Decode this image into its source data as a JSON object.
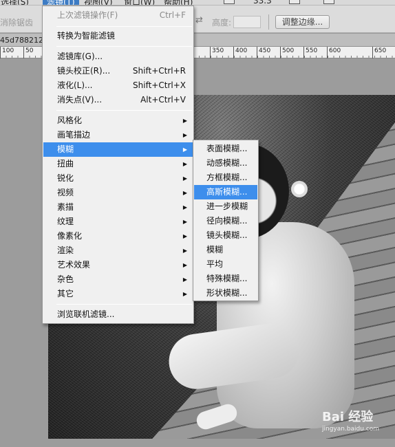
{
  "menubar": {
    "items": [
      "选择(S)",
      "滤镜(T)",
      "视图(V)",
      "窗口(W)",
      "帮助(H)"
    ],
    "zoom": "33.3"
  },
  "options": {
    "antialias_label": "消除锯齿",
    "height_label": "高度:",
    "refine_edge_button": "调整边缘..."
  },
  "document": {
    "tab_name": "45d788212"
  },
  "ruler": {
    "labels": [
      "100",
      "50",
      "350",
      "400",
      "450",
      "500",
      "550",
      "600",
      "650"
    ]
  },
  "filter_menu": {
    "last_filter": {
      "label": "上次滤镜操作(F)",
      "shortcut": "Ctrl+F"
    },
    "smart_filter": "转换为智能滤镜",
    "filter_gallery": "滤镜库(G)...",
    "lens_correction": {
      "label": "镜头校正(R)...",
      "shortcut": "Shift+Ctrl+R"
    },
    "liquify": {
      "label": "液化(L)...",
      "shortcut": "Shift+Ctrl+X"
    },
    "vanishing_point": {
      "label": "消失点(V)...",
      "shortcut": "Alt+Ctrl+V"
    },
    "categories": [
      "风格化",
      "画笔描边",
      "模糊",
      "扭曲",
      "锐化",
      "视频",
      "素描",
      "纹理",
      "像素化",
      "渲染",
      "艺术效果",
      "杂色",
      "其它"
    ],
    "browse_online": "浏览联机滤镜..."
  },
  "blur_submenu": {
    "items": [
      "表面模糊...",
      "动感模糊...",
      "方框模糊...",
      "高斯模糊...",
      "进一步模糊",
      "径向模糊...",
      "镜头模糊...",
      "模糊",
      "平均",
      "特殊模糊...",
      "形状模糊..."
    ]
  },
  "watermark": {
    "brand": "Bai 经验",
    "url": "jingyan.baidu.com"
  },
  "colors": {
    "highlight": "#3d8eec",
    "menu_bg": "#f0f0f0"
  }
}
